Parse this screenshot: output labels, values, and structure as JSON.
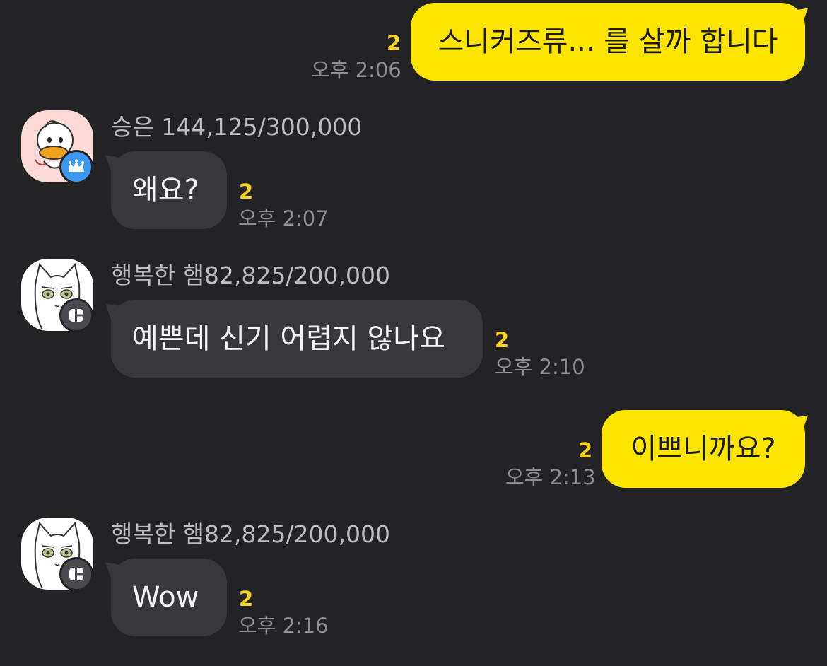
{
  "messages": [
    {
      "side": "me",
      "text": "스니커즈류... 를 살까 합니다",
      "unread": "2",
      "time": "오후 2:06"
    },
    {
      "side": "other",
      "sender": "승은 144,125/300,000",
      "avatar_icon": "duck-character-avatar-icon",
      "badge_icon": "crown-icon",
      "text": "왜요?",
      "unread": "2",
      "time": "오후 2:07"
    },
    {
      "side": "other",
      "sender": "행복한 햄82,825/200,000",
      "avatar_icon": "cat-character-avatar-icon",
      "badge_icon": "host-icon",
      "text": "예쁜데 신기 어렵지 않나요",
      "unread": "2",
      "time": "오후 2:10"
    },
    {
      "side": "me",
      "text": "이쁘니까요?",
      "unread": "2",
      "time": "오후 2:13"
    },
    {
      "side": "other",
      "sender": "행복한 햄82,825/200,000",
      "avatar_icon": "cat-character-avatar-icon",
      "badge_icon": "host-icon",
      "text": "Wow",
      "unread": "2",
      "time": "오후 2:16"
    }
  ],
  "colors": {
    "background": "#232325",
    "my_bubble": "#fee500",
    "other_bubble": "#38383c",
    "unread_count": "#f7d21c",
    "timestamp": "#8e8e92",
    "crown_badge": "#3b97f0"
  }
}
